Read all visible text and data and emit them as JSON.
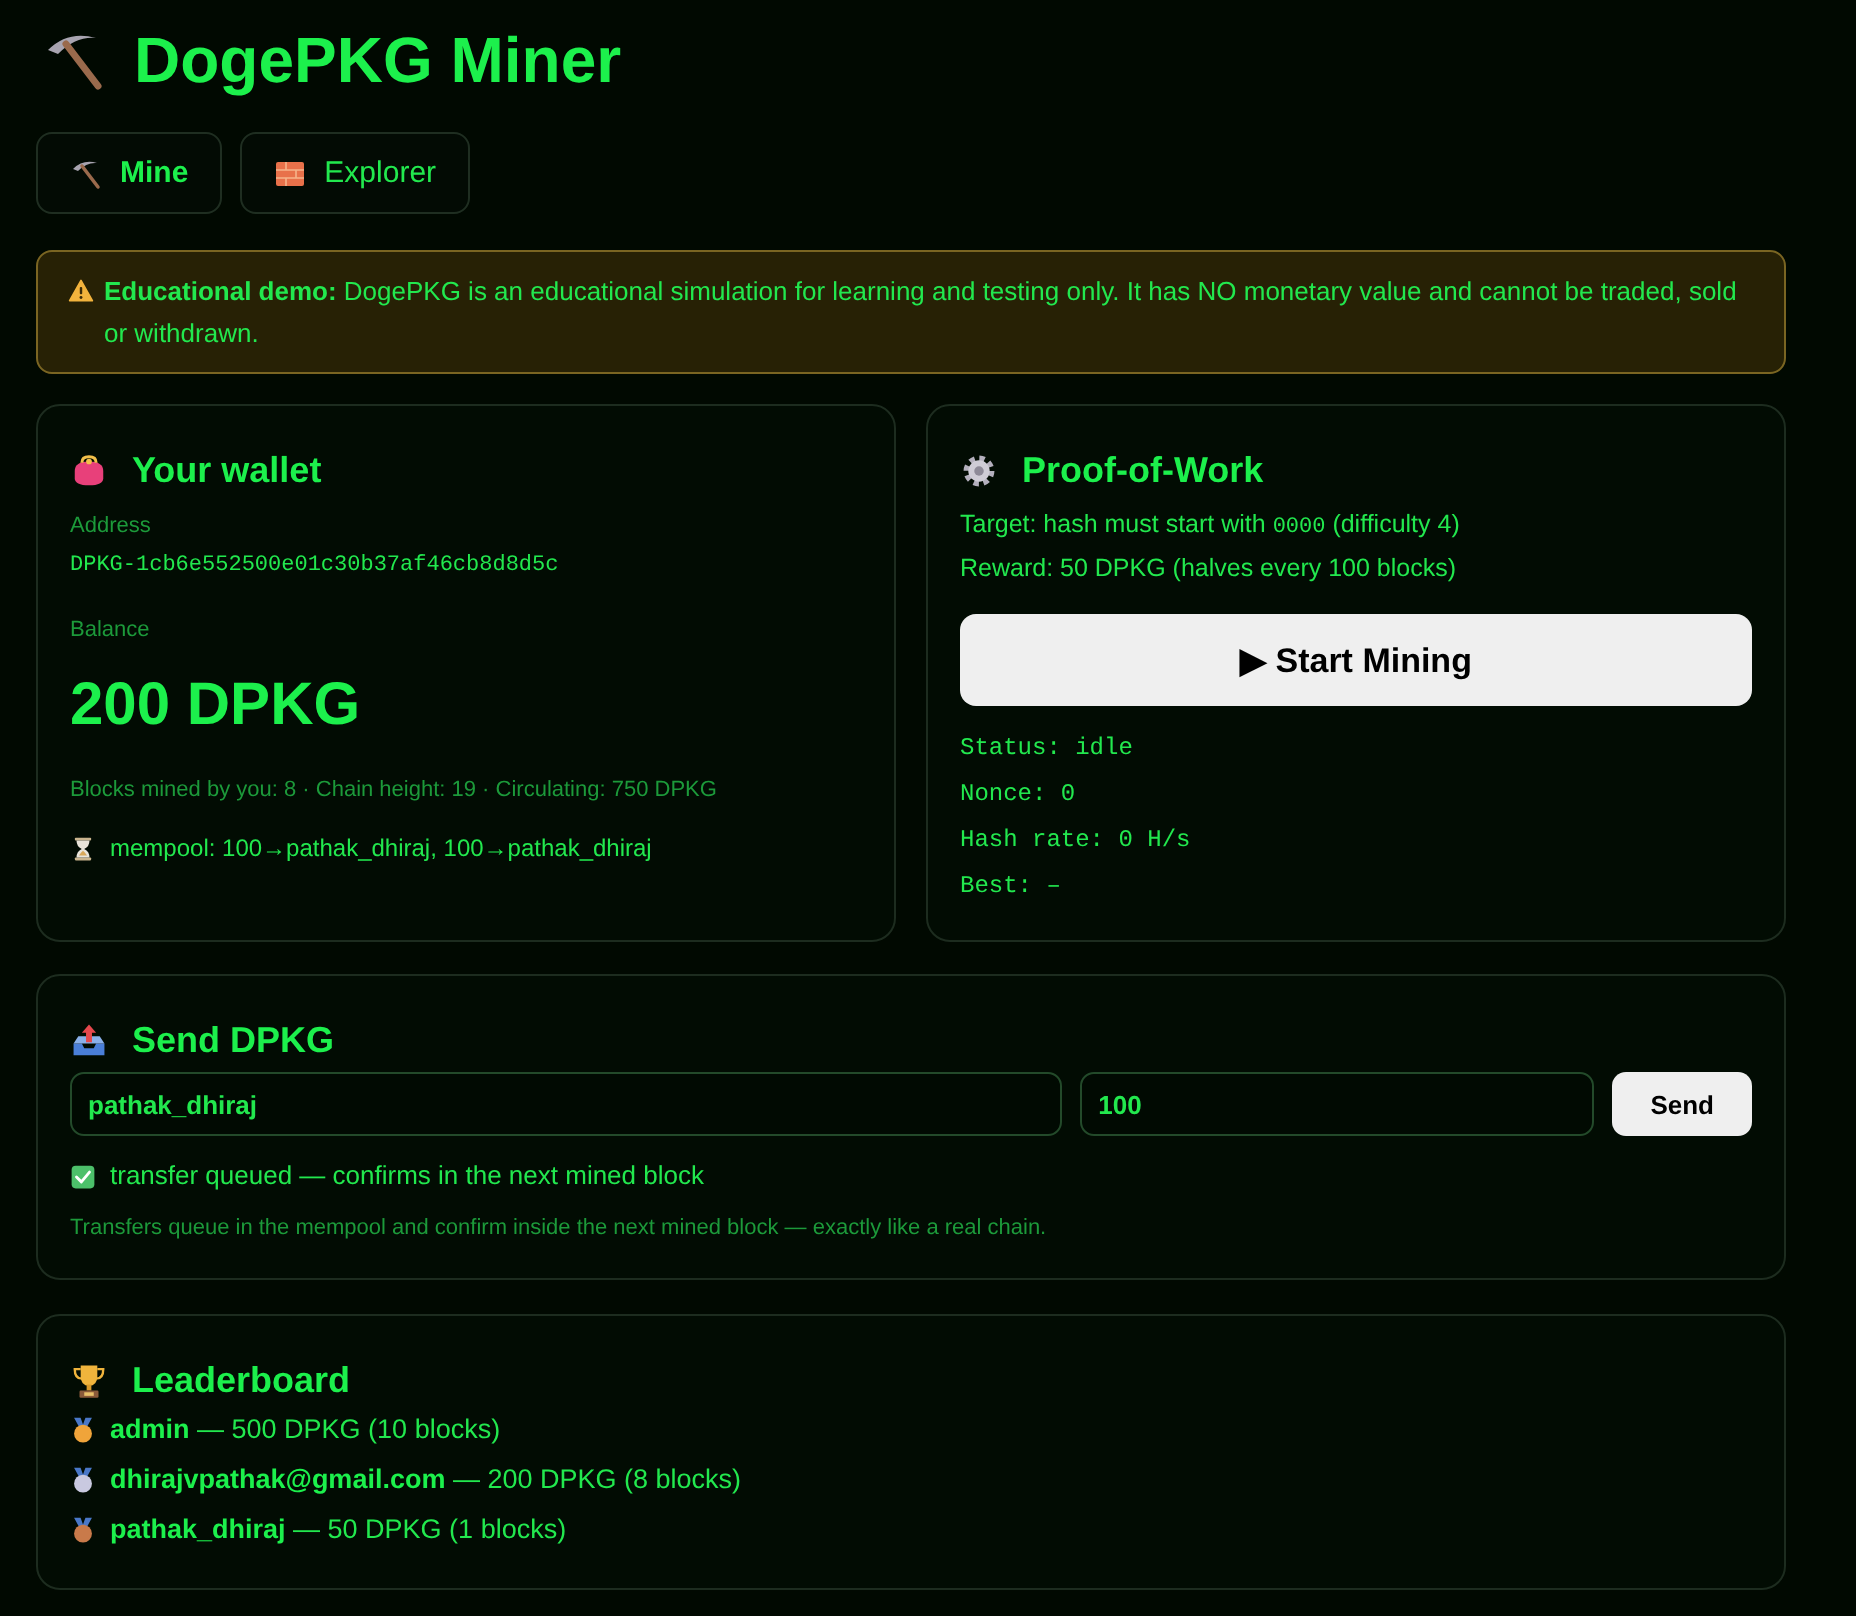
{
  "header": {
    "title": "DogePKG Miner"
  },
  "tabs": [
    {
      "label": "Mine",
      "selected": true
    },
    {
      "label": "Explorer",
      "selected": false
    }
  ],
  "notice": {
    "text": "**Educational demo:** DogePKG is an educational simulation for learning and testing only. It has NO monetary value and cannot be traded, sold or withdrawn."
  },
  "wallet": {
    "title": "Your wallet",
    "address_label": "Address",
    "address": "DPKG-1cb6e552500e01c30b37af46cb8d8d5c",
    "balance_label": "Balance",
    "balance": "200 DPKG",
    "stats": "Blocks mined by you: 8 · Chain height: 19 · Circulating: 750 DPKG",
    "mempool": "mempool: 100→pathak_dhiraj, 100→pathak_dhiraj"
  },
  "proof_of_work": {
    "title": "Proof-of-Work",
    "target": {
      "before": "Target: hash must start with",
      "code": "0000",
      "after": "(difficulty 4)"
    },
    "reward": "Reward: 50 DPKG (halves every 100 blocks)",
    "button": "▶ Start Mining",
    "status_lines": [
      "Status: idle",
      "Nonce: 0",
      "Hash rate: 0 H/s",
      "Best: –"
    ]
  },
  "send": {
    "title": "Send DPKG",
    "recipient": {
      "value": "pathak_dhiraj"
    },
    "amount": {
      "value": "100"
    },
    "button": "Send",
    "confirmation": "transfer queued — confirms in the next mined block",
    "hint": "Transfers queue in the mempool and confirm inside the next mined block — exactly like a real chain."
  },
  "leaderboard": {
    "title": "Leaderboard",
    "entries": [
      {
        "name": "admin",
        "detail": "— 500 DPKG (10 blocks)",
        "color": "#f0a43a"
      },
      {
        "name": "dhirajvpathak@gmail.com",
        "detail": "— 200 DPKG (8 blocks)",
        "color": "#c9c9e0"
      },
      {
        "name": "pathak_dhiraj",
        "detail": "— 50 DPKG (1 blocks)",
        "color": "#c97a4a"
      }
    ]
  }
}
